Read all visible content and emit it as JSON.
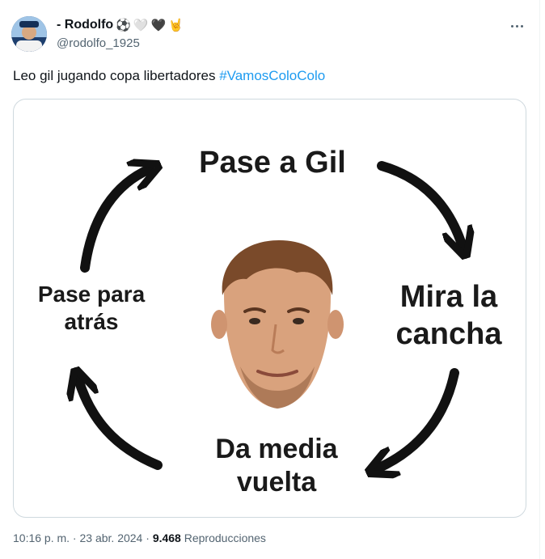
{
  "author": {
    "display_name": "- Rodolfo",
    "emojis": [
      "⚽",
      "🤍",
      "🖤",
      "🤘"
    ],
    "handle": "@rodolfo_1925"
  },
  "tweet": {
    "text": "Leo gil jugando copa libertadores ",
    "hashtag": "#VamosColoColo"
  },
  "meme": {
    "top": "Pase a Gil",
    "right_line1": "Mira la",
    "right_line2": "cancha",
    "bottom_line1": "Da media",
    "bottom_line2": "vuelta",
    "left_line1": "Pase para",
    "left_line2": "atrás"
  },
  "meta": {
    "time": "10:16 p. m.",
    "sep1": " · ",
    "date": "23 abr. 2024",
    "sep2": " · ",
    "views_count": "9.468",
    "views_label": " Reproducciones"
  },
  "colors": {
    "link": "#1d9bf0",
    "secondary_text": "#536471",
    "border": "#cfd9de"
  }
}
